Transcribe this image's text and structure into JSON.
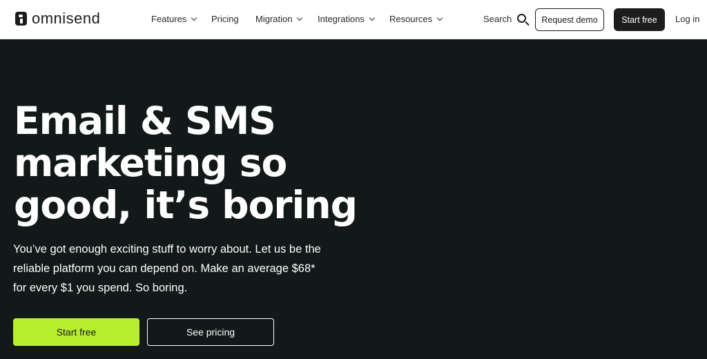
{
  "brand": {
    "name": "omnisend"
  },
  "nav": {
    "items": [
      {
        "label": "Features",
        "has_dropdown": true
      },
      {
        "label": "Pricing",
        "has_dropdown": false
      },
      {
        "label": "Migration",
        "has_dropdown": true
      },
      {
        "label": "Integrations",
        "has_dropdown": true
      },
      {
        "label": "Resources",
        "has_dropdown": true
      }
    ],
    "search_label": "Search",
    "request_demo_label": "Request demo",
    "start_free_label": "Start free",
    "login_label": "Log in"
  },
  "hero": {
    "headline": "Email & SMS marketing so good, it’s boring",
    "subtext": "You’ve got enough exciting stuff to worry about. Let us be the reliable platform you can depend on. Make an average $68* for every $1 you spend. So boring.",
    "primary_cta": "Start free",
    "secondary_cta": "See pricing"
  },
  "colors": {
    "hero_bg": "#121918",
    "accent_green": "#b6ef2e",
    "nav_bg": "#ffffff",
    "dark_button": "#1d1d1d"
  }
}
